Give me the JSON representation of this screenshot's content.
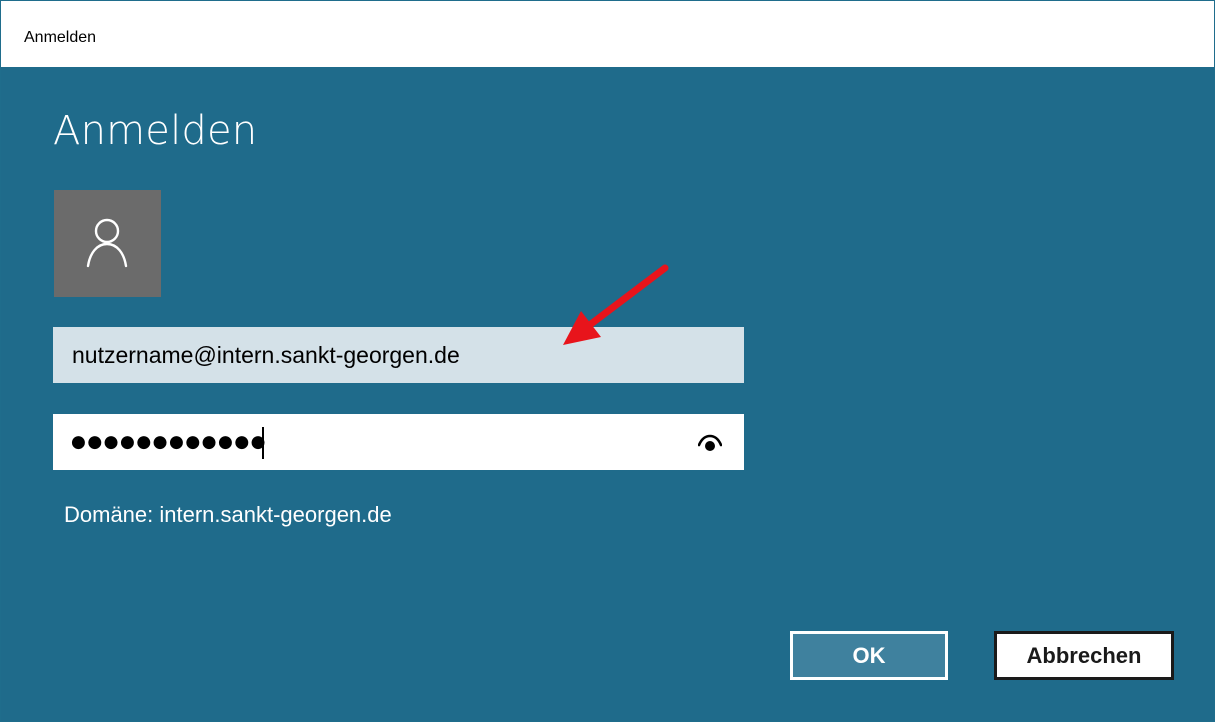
{
  "window": {
    "title": "Anmelden"
  },
  "dialog": {
    "heading": "Anmelden",
    "avatar_icon": "user-icon",
    "username": {
      "value": "nutzername@intern.sankt-georgen.de"
    },
    "password": {
      "masked_value": "●●●●●●●●●●●●",
      "reveal_icon": "eye-icon"
    },
    "domain_label": "Domäne: intern.sankt-georgen.de",
    "buttons": {
      "ok_label": "OK",
      "cancel_label": "Abbrechen"
    }
  },
  "annotation": {
    "type": "arrow",
    "color": "#e8141b"
  },
  "colors": {
    "background": "#1f6b8b",
    "avatar": "#6b6b6b",
    "username_field": "#d4e1e8",
    "ok_button": "#3f819e"
  }
}
